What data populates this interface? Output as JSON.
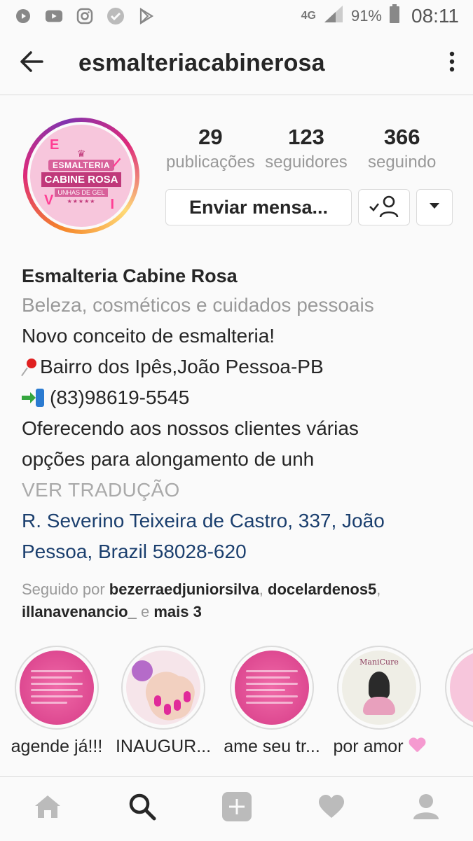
{
  "status_bar": {
    "network": "4G",
    "battery": "91%",
    "time": "08:11"
  },
  "header": {
    "username": "esmalteriacabinerosa"
  },
  "avatar": {
    "line1": "ESMALTERIA",
    "line2": "CABINE ROSA",
    "line3": "UNHAS DE GEL"
  },
  "stats": [
    {
      "value": "29",
      "label": "publicações"
    },
    {
      "value": "123",
      "label": "seguidores"
    },
    {
      "value": "366",
      "label": "seguindo"
    }
  ],
  "actions": {
    "message_label": "Enviar mensa..."
  },
  "bio": {
    "name": "Esmalteria Cabine Rosa",
    "category": "Beleza, cosméticos e cuidados pessoais",
    "line1": "Novo conceito de esmalteria!",
    "line2": "Bairro dos Ipês,João Pessoa-PB",
    "line3": "(83)98619-5545",
    "line4": "Oferecendo aos nossos clientes várias",
    "line5": "opções para alongamento  de unh",
    "translate": "VER TRADUÇÃO",
    "address_line1": "R. Severino Teixeira de Castro, 337, João",
    "address_line2": "Pessoa, Brazil 58028-620"
  },
  "followed_by": {
    "prefix": "Seguido por",
    "user1": "bezerraedjuniorsilva",
    "sep1": ",",
    "user2": "docelardenos5",
    "sep2": ",",
    "user3": "illanavenancio_",
    "conj": "e",
    "more": "mais 3"
  },
  "highlights": [
    {
      "label": "agende já!!!"
    },
    {
      "label": "INAUGUR..."
    },
    {
      "label": "ame seu tr..."
    },
    {
      "label": "por amor",
      "manicure_title": "ManiCure"
    }
  ],
  "colors": {
    "link": "#1b3f6e",
    "muted": "#999999",
    "text": "#262626",
    "brand_pink": "#d63b87"
  },
  "nav": [
    "home-icon",
    "search-icon",
    "add-icon",
    "heart-icon",
    "profile-icon"
  ]
}
